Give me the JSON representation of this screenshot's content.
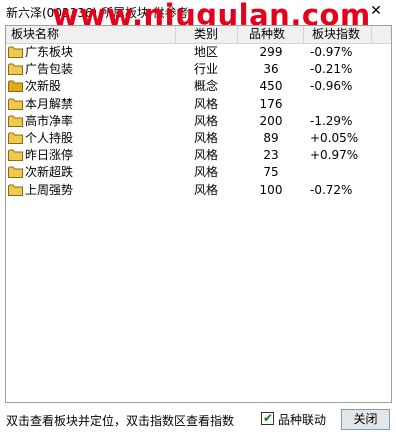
{
  "window": {
    "title": "新六泽(002336)  所属板块 供参考",
    "watermark": "www.niugulan.com"
  },
  "table": {
    "headers": [
      "板块名称",
      "类别",
      "品种数",
      "板块指数"
    ],
    "rows": [
      {
        "name": "广东板块",
        "category": "地区",
        "count": "299",
        "index": "-0.97%",
        "selected": false
      },
      {
        "name": "广告包装",
        "category": "行业",
        "count": "36",
        "index": "-0.21%",
        "selected": false
      },
      {
        "name": "次新股",
        "category": "概念",
        "count": "450",
        "index": "-0.96%",
        "selected": true
      },
      {
        "name": "本月解禁",
        "category": "风格",
        "count": "176",
        "index": "",
        "selected": false
      },
      {
        "name": "高市净率",
        "category": "风格",
        "count": "200",
        "index": "-1.29%",
        "selected": false
      },
      {
        "name": "个人持股",
        "category": "风格",
        "count": "89",
        "index": "+0.05%",
        "selected": false
      },
      {
        "name": "昨日涨停",
        "category": "风格",
        "count": "23",
        "index": "+0.97%",
        "selected": false
      },
      {
        "name": "次新超跌",
        "category": "风格",
        "count": "75",
        "index": "",
        "selected": false
      },
      {
        "name": "上周强势",
        "category": "风格",
        "count": "100",
        "index": "-0.72%",
        "selected": false
      }
    ]
  },
  "status": {
    "hint": "双击查看板块并定位，双击指数区查看指数",
    "linkage_label": "品种联动",
    "linkage_checked": true,
    "close_label": "关闭"
  },
  "colors": {
    "folder": "#f2c94c",
    "folder_selected": "#e3a813",
    "watermark": "#e6001a",
    "button_border": "#7a9cd3"
  }
}
